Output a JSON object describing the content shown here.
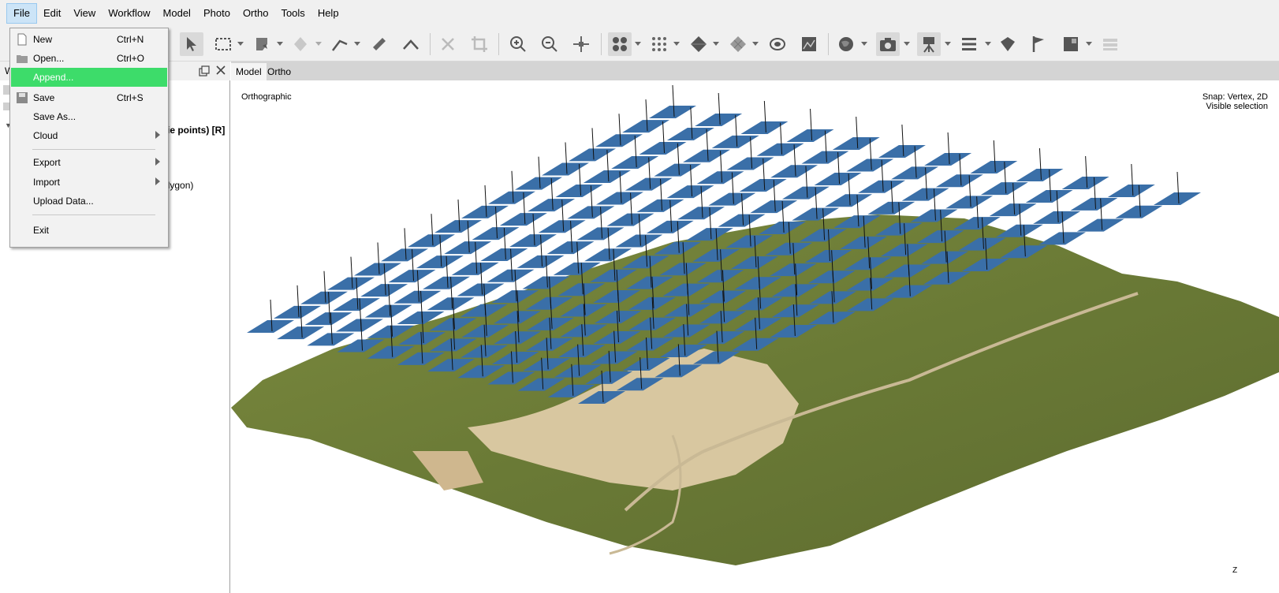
{
  "menubar": {
    "items": [
      "File",
      "Edit",
      "View",
      "Workflow",
      "Model",
      "Photo",
      "Ortho",
      "Tools",
      "Help"
    ],
    "active_item": "File"
  },
  "file_menu": {
    "items": [
      {
        "label": "New",
        "shortcut": "Ctrl+N",
        "icon": "new-document-icon"
      },
      {
        "label": "Open...",
        "shortcut": "Ctrl+O",
        "icon": "open-folder-icon"
      },
      {
        "label": "Append...",
        "shortcut": "",
        "icon": "",
        "highlighted": true
      },
      {
        "label": "Save",
        "shortcut": "Ctrl+S",
        "icon": "save-disk-icon"
      },
      {
        "label": "Save As...",
        "shortcut": ""
      },
      {
        "label": "Cloud",
        "submenu": true
      },
      {
        "label": "Export",
        "submenu": true
      },
      {
        "label": "Import",
        "submenu": true
      },
      {
        "label": "Upload Data..."
      },
      {
        "label": "Exit"
      }
    ],
    "highlight_color": "#3ddc6a"
  },
  "left_panel": {
    "title": "W",
    "visible_text_1": "tie points) [R]",
    "visible_text_2": "olygon)"
  },
  "viewport": {
    "tabs": [
      "Model",
      "Ortho"
    ],
    "active_tab": "Model",
    "projection_label": "Orthographic",
    "snap_label": "Snap: Vertex, 2D",
    "selection_label": "Visible selection",
    "axis_label": "Z"
  },
  "colors": {
    "camera_plane": "#3a6fa8",
    "terrain_green": "#6f7f3a",
    "terrain_sand": "#d9c9a3",
    "menu_highlight": "#3ddc6a"
  },
  "toolbar_icons": [
    "select-arrow-icon",
    "rectangle-selection-icon",
    "polygon-selection-icon",
    "free-selection-icon",
    "marker-pointer-icon",
    "ruler-icon",
    "angle-icon",
    "delete-icon",
    "crop-icon",
    "zoom-in-icon",
    "zoom-out-icon",
    "move-icon",
    "point-cloud-icon",
    "dense-cloud-icon",
    "mesh-icon",
    "tiled-model-icon",
    "dem-icon",
    "orthomosaic-icon",
    "globe-icon",
    "camera-icon",
    "tripod-camera-icon",
    "layers-icon",
    "shape-icon",
    "flag-icon",
    "image-icon",
    "stack-icon"
  ]
}
